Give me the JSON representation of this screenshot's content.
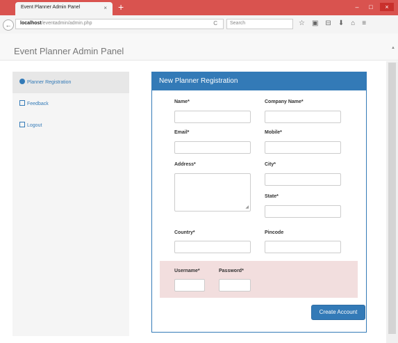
{
  "browser": {
    "tab_title": "Event Planner Admin Panel",
    "tab_close": "×",
    "new_tab": "+",
    "url_host": "localhost",
    "url_path": "/eventadmin/admin.php",
    "search_placeholder": "Search",
    "reload_glyph": "C",
    "back_glyph": "←",
    "window_buttons": [
      "–",
      "□",
      "×"
    ],
    "toolbar_icons": [
      "☆",
      "▣",
      "⊟",
      "⬇",
      "⌂",
      "≡"
    ]
  },
  "header": {
    "brand": "Event Planner Admin Panel"
  },
  "sidebar": {
    "items": [
      {
        "label": "Planner Registration",
        "icon": "user-circle-icon",
        "active": true
      },
      {
        "label": "Feedback",
        "icon": "edit-icon",
        "active": false
      },
      {
        "label": "Logout",
        "icon": "logout-icon",
        "active": false
      }
    ]
  },
  "form": {
    "title": "New Planner Registration",
    "labels": {
      "name": "Name*",
      "company_name": "Company Name*",
      "email": "Email*",
      "mobile": "Mobile*",
      "address": "Address*",
      "city": "City*",
      "state": "State*",
      "country": "Country*",
      "pincode": "Pincode",
      "username": "Username*",
      "password": "Password*"
    },
    "values": {
      "name": "",
      "company_name": "",
      "email": "",
      "mobile": "",
      "address": "",
      "city": "",
      "state": "",
      "country": "",
      "pincode": "",
      "username": "",
      "password": ""
    },
    "submit_label": "Create Account"
  },
  "colors": {
    "titlebar": "#d9534f",
    "primary": "#337ab7",
    "credentials_bg": "#f2dede",
    "sidebar_bg": "#f5f5f5"
  }
}
